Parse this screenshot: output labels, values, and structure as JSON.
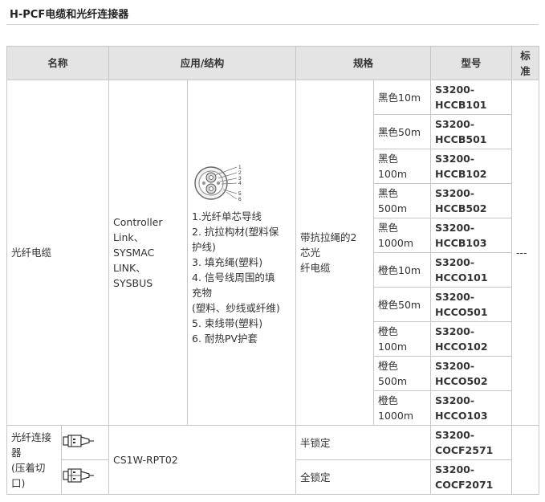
{
  "section_title": "H-PCF电缆和光纤连接器",
  "headers": {
    "name": "名称",
    "application": "应用/结构",
    "spec": "规格",
    "model": "型号",
    "standard": "标准"
  },
  "cable": {
    "name": "光纤电缆",
    "application_lines": [
      "Controller",
      "Link、",
      "SYSMAC",
      "LINK、",
      "SYSBUS"
    ],
    "structure_items": [
      "1.光纤单芯导线",
      "2. 抗拉构材(塑料保",
      "护线)",
      "3. 填充绳(塑料)",
      "4. 信号线周围的填",
      "充物",
      "(塑料、纱线或纤维)",
      "5. 束线带(塑料)",
      "6. 耐热PV护套"
    ],
    "diagram_labels": [
      "1",
      "2",
      "3",
      "4",
      "5",
      "6"
    ],
    "spec_lines": [
      "带抗拉绳的2",
      "芯光",
      "纤电缆"
    ],
    "variants": [
      {
        "spec": [
          "黑色10m"
        ],
        "model": [
          "S3200-",
          "HCCB101"
        ]
      },
      {
        "spec": [
          "黑色50m"
        ],
        "model": [
          "S3200-",
          "HCCB501"
        ]
      },
      {
        "spec": [
          "黑色",
          "100m"
        ],
        "model": [
          "S3200-",
          "HCCB102"
        ]
      },
      {
        "spec": [
          "黑色",
          "500m"
        ],
        "model": [
          "S3200-",
          "HCCB502"
        ]
      },
      {
        "spec": [
          "黑色",
          "1000m"
        ],
        "model": [
          "S3200-",
          "HCCB103"
        ]
      },
      {
        "spec": [
          "橙色10m"
        ],
        "model": [
          "S3200-",
          "HCCO101"
        ]
      },
      {
        "spec": [
          "橙色50m"
        ],
        "model": [
          "S3200-",
          "HCCO501"
        ]
      },
      {
        "spec": [
          "橙色",
          "100m"
        ],
        "model": [
          "S3200-",
          "HCCO102"
        ]
      },
      {
        "spec": [
          "橙色",
          "500m"
        ],
        "model": [
          "S3200-",
          "HCCO502"
        ]
      },
      {
        "spec": [
          "橙色",
          "1000m"
        ],
        "model": [
          "S3200-",
          "HCCO103"
        ]
      }
    ],
    "standard": "---"
  },
  "connector": {
    "name_lines": [
      "光纤连接",
      "器",
      "(压着切",
      "口)"
    ],
    "application": "CS1W-RPT02",
    "variants": [
      {
        "spec": "半锁定",
        "model": [
          "S3200-",
          "COCF2571"
        ]
      },
      {
        "spec": "全锁定",
        "model": [
          "S3200-",
          "COCF2071"
        ]
      }
    ]
  }
}
